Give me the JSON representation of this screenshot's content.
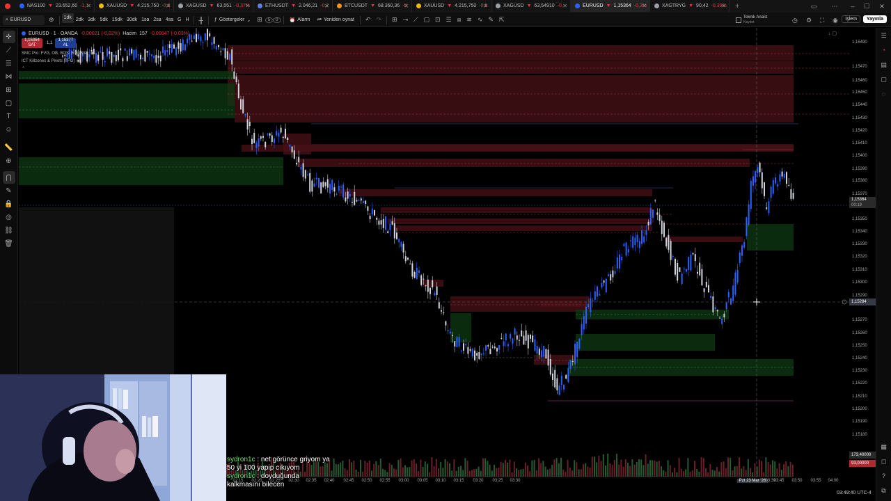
{
  "tabs": [
    {
      "symbol": "NAS100",
      "price": "23.652,60",
      "change": "-1,1",
      "color": "#2962ff"
    },
    {
      "symbol": "XAUUSD",
      "price": "4.215,750",
      "change": "-0,5",
      "color": "#f0b90b"
    },
    {
      "symbol": "XAGUSD",
      "price": "63,551",
      "change": "-0,37%",
      "color": "#9aa0a6"
    },
    {
      "symbol": "ETHUSDT",
      "price": "2.046,21",
      "change": "-0,2",
      "color": "#627eea"
    },
    {
      "symbol": "BTCUSDT",
      "price": "68.360,36",
      "change": "-0,",
      "color": "#f7931a"
    },
    {
      "symbol": "XAUUSD",
      "price": "4.215,750",
      "change": "-0,5",
      "color": "#f0b90b"
    },
    {
      "symbol": "XAGUSD",
      "price": "63,54910",
      "change": "-0,",
      "color": "#9aa0a6"
    },
    {
      "symbol": "EURUSD",
      "price": "1,15364",
      "change": "-0,3%",
      "color": "#2962ff"
    },
    {
      "symbol": "XAGTRYG",
      "price": "90,42",
      "change": "-0,39%",
      "color": "#9aa0a6"
    }
  ],
  "toolbar": {
    "symbol": "EURUSD",
    "intervals": [
      "1dk",
      "2dk",
      "3dk",
      "5dk",
      "15dk",
      "30dk",
      "1sa",
      "2sa",
      "4sa",
      "G",
      "H"
    ],
    "active_interval": "1dk",
    "indicators_label": "Göstergeler",
    "alarm_label": "Alarm",
    "replay_label": "Yeniden oynat",
    "analysis_label": "Teknik Analiz",
    "analysis_sub": "Kaydet",
    "trade_label": "İşlem",
    "publish_label": "Yayınla"
  },
  "legend": {
    "title": "EURUSD · 1 · OANDA",
    "ohlc": "-0,00021 (-0,02%)",
    "volume_label": "Hacim",
    "volume_value": "157",
    "volume_change": "-0,00047 (-0,03%)",
    "sell_price": "1,15354",
    "sell_label": "SAT",
    "spread": "1,1",
    "buy_price": "1,15377",
    "buy_label": "AL",
    "indicator1": "SMC Pro: FVG, OB, BOS, BSL/SSL",
    "indicator2": "ICT Killzones & Pivots [TFO]"
  },
  "price_axis": {
    "labels": [
      "1,15490",
      "1,15470",
      "1,15460",
      "1,15450",
      "1,15440",
      "1,15430",
      "1,15420",
      "1,15410",
      "1,15400",
      "1,15390",
      "1,15380",
      "1,15370",
      "1,15350",
      "1,15340",
      "1,15330",
      "1,15320",
      "1,15310",
      "1,15300",
      "1,15290",
      "1,15270",
      "1,15260",
      "1,15250",
      "1,15240",
      "1,15230",
      "1,15220",
      "1,15210",
      "1,15200",
      "1,15190",
      "1,15180"
    ],
    "current_price": "1,15364",
    "current_countdown": "00:19",
    "crosshair_price": "1,15284",
    "volume_tag": "173,40000",
    "volume_tag2": "93,00000"
  },
  "time_axis": {
    "labels": [
      "01:15",
      "01:20",
      "01:25",
      "01:30",
      "01:35",
      "01:40",
      "01:45",
      "01:50",
      "01:55",
      "02:00",
      "02:05",
      "02:10",
      "02:15",
      "02:20",
      "02:25",
      "02:30",
      "02:35",
      "02:40",
      "02:45",
      "02:50",
      "02:55",
      "03:00",
      "03:05",
      "03:10",
      "03:15",
      "03:20",
      "03:25",
      "03:30",
      "Pzt 23 Mar '26",
      "03:39",
      "03:45",
      "03:50",
      "03:55",
      "04:00"
    ],
    "cursor_label": "Pzt 23 Mar '26  03:39"
  },
  "chat": [
    {
      "user": "sydron1c",
      "message": "net görünce griyom ya"
    },
    {
      "user": "",
      "message": "50 yi 100 yapip cıkıyom"
    },
    {
      "user": "sydron1c",
      "message": "doyduğunda"
    },
    {
      "user": "",
      "message": "kalkmasını bilecen"
    }
  ],
  "clock": "03:49:40 UTC-4",
  "colors": {
    "up_candle": "#2962ff",
    "down_candle": "#d1d4dc",
    "bearish_zone": "#4a1218",
    "bullish_zone": "#0f3a14",
    "background": "#000000"
  }
}
